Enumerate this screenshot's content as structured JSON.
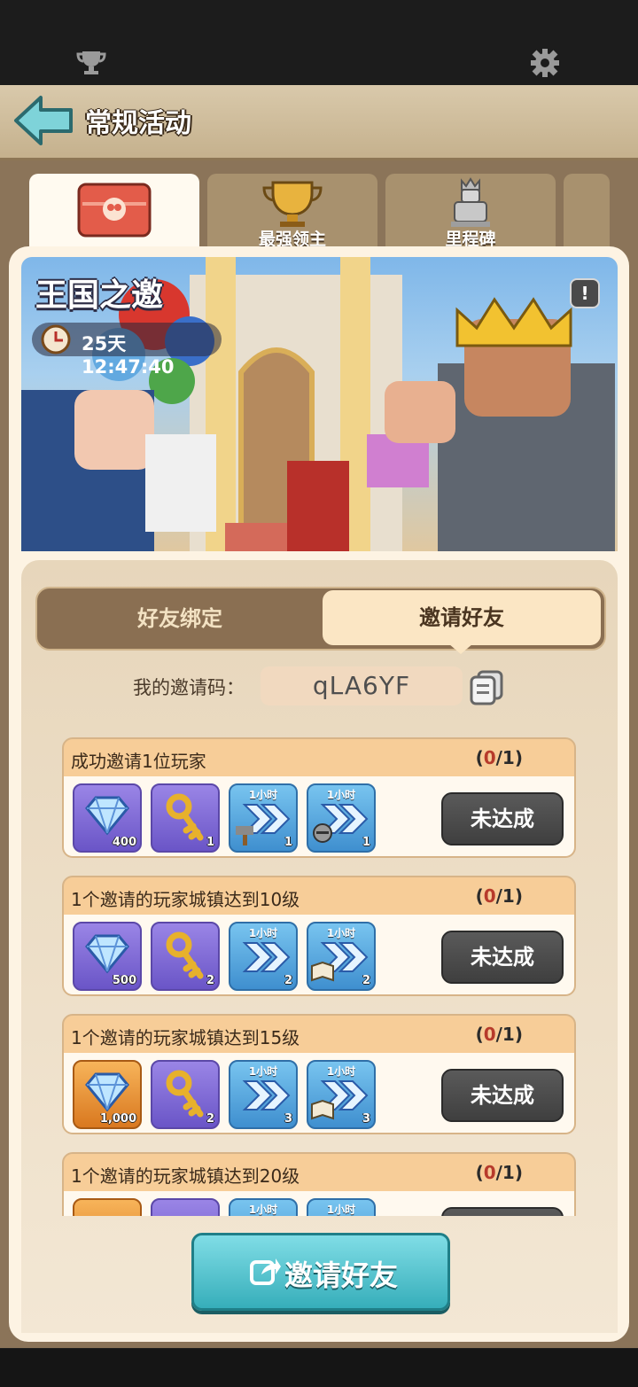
{
  "header": {
    "title": "常规活动"
  },
  "tabs": [
    {
      "label": ""
    },
    {
      "label": "最强领主"
    },
    {
      "label": "里程碑"
    }
  ],
  "banner": {
    "title": "王国之邀",
    "timer": "25天 12:47:40",
    "info_icon": "!"
  },
  "segments": {
    "left": "好友绑定",
    "right": "邀请好友"
  },
  "invite_code": {
    "label": "我的邀请码：",
    "value": "qLA6YF"
  },
  "tasks": [
    {
      "title": "成功邀请1位玩家",
      "progress_zero": "0",
      "progress_rest": "/1",
      "button": "未达成",
      "rewards": [
        {
          "qty": "400"
        },
        {
          "qty": "1"
        },
        {
          "tag": "1小时",
          "qty": "1"
        },
        {
          "tag": "1小时",
          "qty": "1"
        }
      ]
    },
    {
      "title": "1个邀请的玩家城镇达到10级",
      "progress_zero": "0",
      "progress_rest": "/1",
      "button": "未达成",
      "rewards": [
        {
          "qty": "500"
        },
        {
          "qty": "2"
        },
        {
          "tag": "1小时",
          "qty": "2"
        },
        {
          "tag": "1小时",
          "qty": "2"
        }
      ]
    },
    {
      "title": "1个邀请的玩家城镇达到15级",
      "progress_zero": "0",
      "progress_rest": "/1",
      "button": "未达成",
      "rewards": [
        {
          "qty": "1,000"
        },
        {
          "qty": "2"
        },
        {
          "tag": "1小时",
          "qty": "3"
        },
        {
          "tag": "1小时",
          "qty": "3"
        }
      ]
    },
    {
      "title": "1个邀请的玩家城镇达到20级",
      "progress_zero": "0",
      "progress_rest": "/1",
      "button": "",
      "rewards": [
        {
          "qty": ""
        },
        {
          "qty": ""
        },
        {
          "tag": "1小时",
          "qty": ""
        },
        {
          "tag": "1小时",
          "qty": ""
        }
      ]
    }
  ],
  "invite_button": "邀请好友"
}
